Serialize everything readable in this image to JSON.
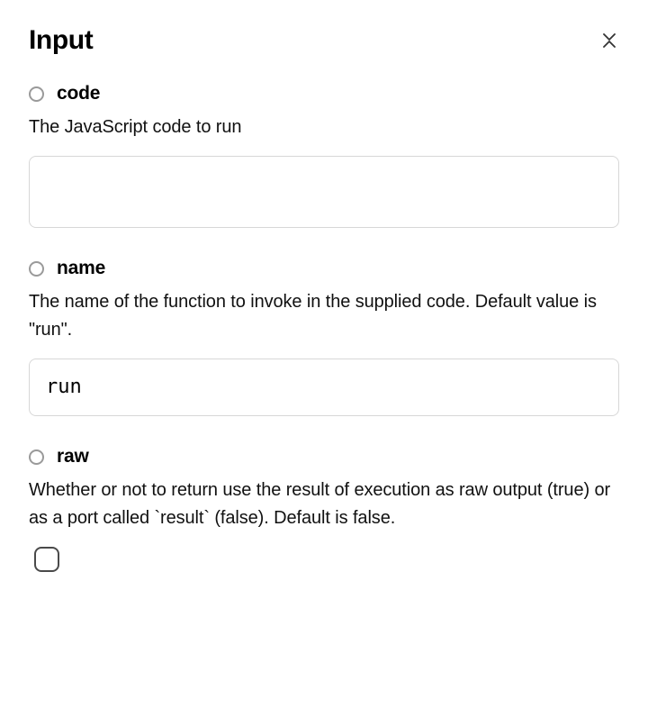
{
  "header": {
    "title": "Input"
  },
  "fields": {
    "code": {
      "label": "code",
      "description": "The JavaScript code to run",
      "value": ""
    },
    "name": {
      "label": "name",
      "description": "The name of the function to invoke in the supplied code. Default value is \"run\".",
      "value": "run"
    },
    "raw": {
      "label": "raw",
      "description": "Whether or not to return use the result of execution as raw output (true) or as a port called `result` (false). Default is false.",
      "checked": false
    }
  }
}
